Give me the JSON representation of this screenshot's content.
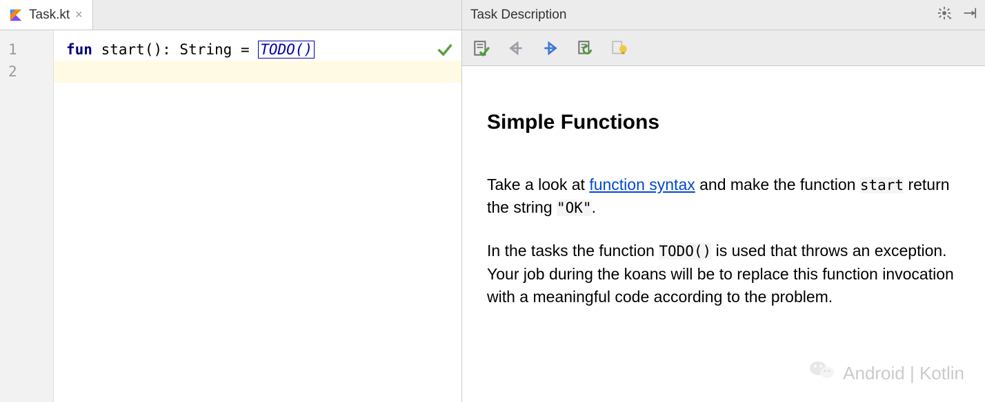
{
  "editor": {
    "tabs": [
      {
        "filename": "Task.kt",
        "icon": "kotlin-file-icon"
      }
    ],
    "gutter": [
      "1",
      "2"
    ],
    "code": {
      "keyword": "fun",
      "fn_name": "start",
      "parens": "()",
      "colon": ":",
      "return_type": "String",
      "equals": "=",
      "todo": "TODO()"
    },
    "status_icon": "check-ok-icon"
  },
  "task_panel": {
    "header_title": "Task Description",
    "header_icons": [
      "gear-icon",
      "hide-panel-icon"
    ],
    "toolbar_icons": [
      "check-task-icon",
      "back-icon",
      "forward-icon",
      "reset-icon",
      "hint-bulb-icon"
    ],
    "title": "Simple Functions",
    "paragraph1_prefix": "Take a look at ",
    "link_text": "function syntax",
    "paragraph1_mid": " and make the function ",
    "code_start": "start",
    "paragraph1_mid2": " return the string ",
    "code_ok": "\"OK\"",
    "paragraph1_suffix": ".",
    "paragraph2_prefix": "In the tasks the function ",
    "code_todo": "TODO()",
    "paragraph2_suffix": " is used that throws an exception. Your job during the koans will be to replace this function invocation with a meaningful code according to the problem."
  },
  "watermark": {
    "text": "Android | Kotlin"
  }
}
